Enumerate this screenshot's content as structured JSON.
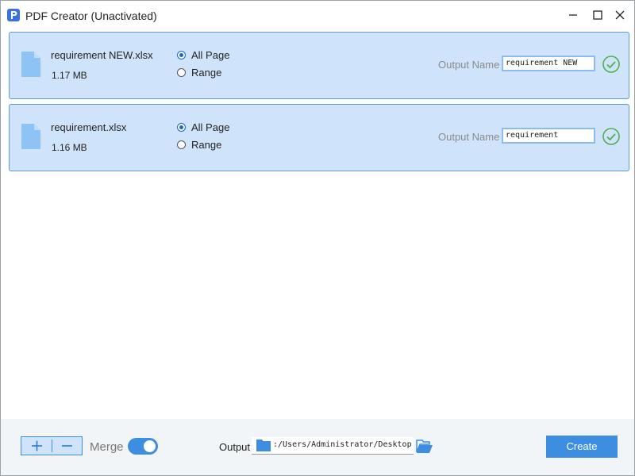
{
  "window": {
    "title": "PDF Creator (Unactivated)"
  },
  "files": [
    {
      "name": "requirement NEW.xlsx",
      "size": "1.17 MB",
      "page_option": "All Page",
      "options": [
        "All Page",
        "Range"
      ],
      "output_label": "Output Name",
      "output_name": "requirement NEW",
      "status_icon": "check-circle-icon"
    },
    {
      "name": "requirement.xlsx",
      "size": "1.16 MB",
      "page_option": "All Page",
      "options": [
        "All Page",
        "Range"
      ],
      "output_label": "Output Name",
      "output_name": "requirement",
      "status_icon": "check-circle-icon"
    }
  ],
  "bottombar": {
    "merge_label": "Merge",
    "merge_enabled": true,
    "output_label": "Output",
    "output_path": ":/Users/Administrator/Desktop",
    "create_label": "Create"
  },
  "colors": {
    "accent": "#3d8ee0",
    "row_bg": "#cfe4fb",
    "row_border": "#5a9ad8",
    "check": "#4caf50",
    "file_icon": "#8ec4f5"
  }
}
